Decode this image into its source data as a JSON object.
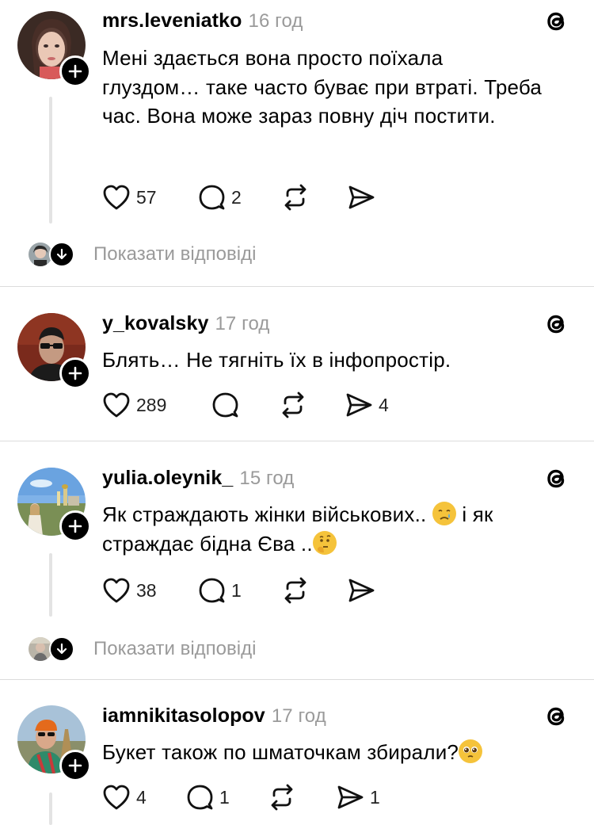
{
  "comments": [
    {
      "username": "mrs.leveniatko",
      "time": "16 год",
      "text": "Мені здається вона просто поїхала глуздом… таке часто буває при втраті. Треба час. Вона може зараз повну діч постити.",
      "likes": "57",
      "comments": "2",
      "reposts": "",
      "shares": "",
      "show_replies": "Показати відповіді"
    },
    {
      "username": "y_kovalsky",
      "time": "17 год",
      "text": "Блять… Не тягніть їх в інфопростір.",
      "likes": "289",
      "comments": "",
      "reposts": "",
      "shares": "4"
    },
    {
      "username": "yulia.oleynik_",
      "time": "15 год",
      "text_line1": "Як страждають жінки військових..",
      "text_line1_tail": "і як",
      "text_line2": "страждає бідна Єва ..",
      "likes": "38",
      "comments": "1",
      "reposts": "",
      "shares": "",
      "show_replies": "Показати відповіді"
    },
    {
      "username": "iamnikitasolopov",
      "time": "17 год",
      "text": "Букет також по шматочкам збирали?",
      "likes": "4",
      "comments": "1",
      "reposts": "",
      "shares": "1"
    }
  ],
  "icons": {
    "like": "heart-icon",
    "comment": "comment-icon",
    "repost": "repost-icon",
    "share": "share-icon",
    "brand": "threads-icon",
    "follow": "plus-icon",
    "show_replies": "arrow-down-icon"
  }
}
